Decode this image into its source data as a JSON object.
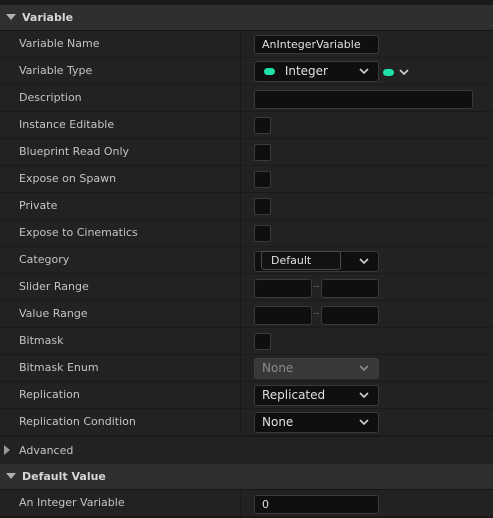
{
  "sections": {
    "variable_title": "Variable",
    "default_value_title": "Default Value"
  },
  "rows": {
    "variable_name": {
      "label": "Variable Name",
      "value": "AnIntegerVariable"
    },
    "variable_type": {
      "label": "Variable Type",
      "value": "Integer",
      "pin_color": "#1fe0a8"
    },
    "description": {
      "label": "Description",
      "value": ""
    },
    "instance_editable": {
      "label": "Instance Editable",
      "checked": false
    },
    "blueprint_read_only": {
      "label": "Blueprint Read Only",
      "checked": false
    },
    "expose_on_spawn": {
      "label": "Expose on Spawn",
      "checked": false
    },
    "private": {
      "label": "Private",
      "checked": false
    },
    "expose_to_cinematics": {
      "label": "Expose to Cinematics",
      "checked": false
    },
    "category": {
      "label": "Category",
      "value": "Default"
    },
    "slider_range": {
      "label": "Slider Range",
      "separator": "..",
      "min": "",
      "max": ""
    },
    "value_range": {
      "label": "Value Range",
      "separator": "..",
      "min": "",
      "max": ""
    },
    "bitmask": {
      "label": "Bitmask",
      "checked": false
    },
    "bitmask_enum": {
      "label": "Bitmask Enum",
      "value": "None"
    },
    "replication": {
      "label": "Replication",
      "value": "Replicated"
    },
    "replication_condition": {
      "label": "Replication Condition",
      "value": "None"
    },
    "advanced": {
      "label": "Advanced"
    },
    "an_integer_variable": {
      "label": "An Integer Variable",
      "value": "0"
    }
  },
  "colors": {
    "accent_pin": "#1fe0a8",
    "panel_bg": "#222222",
    "header_bg": "#2f2f2f"
  }
}
